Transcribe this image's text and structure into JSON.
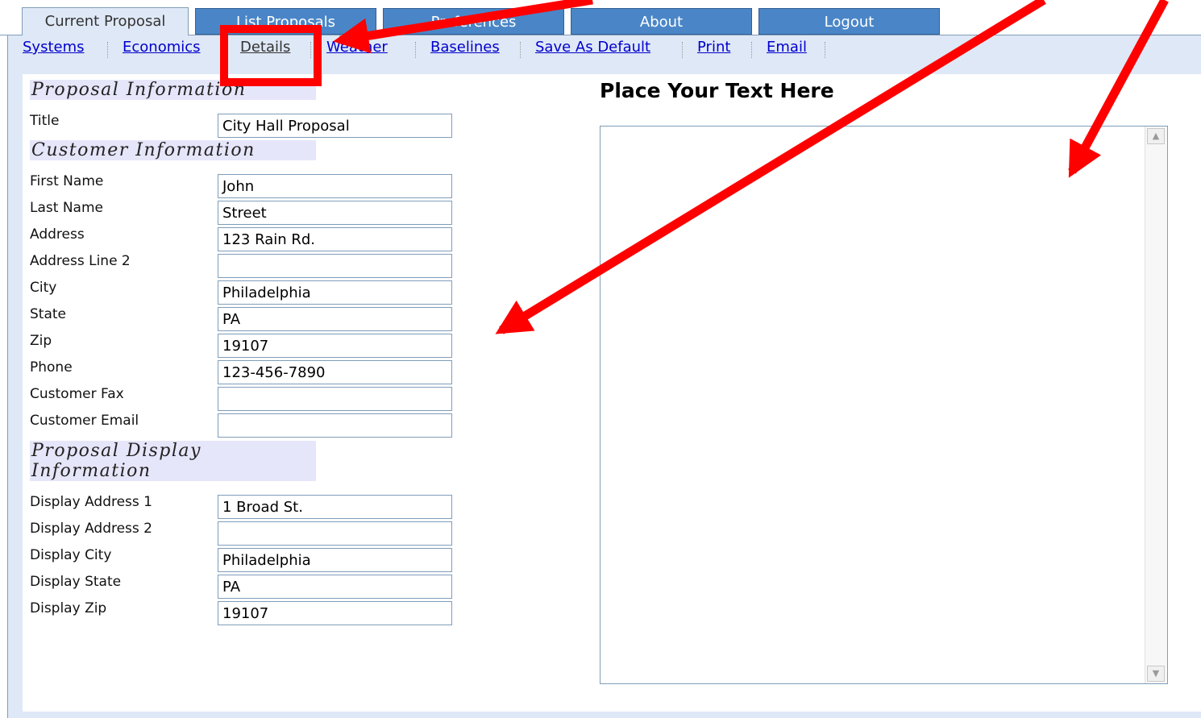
{
  "tabs": [
    {
      "label": "Current Proposal",
      "active": true
    },
    {
      "label": "List Proposals",
      "active": false
    },
    {
      "label": "Preferences",
      "active": false
    },
    {
      "label": "About",
      "active": false
    },
    {
      "label": "Logout",
      "active": false
    }
  ],
  "subnav": {
    "systems": "Systems",
    "economics": "Economics",
    "details": "Details",
    "weather": "Weather",
    "baselines": "Baselines",
    "save_default": "Save As Default",
    "print": "Print",
    "email": "Email"
  },
  "sections": {
    "proposal_info": "Proposal Information",
    "customer_info": "Customer Information",
    "display_info_line1": "Proposal Display",
    "display_info_line2": "Information"
  },
  "fields": {
    "title": {
      "label": "Title",
      "value": "City Hall Proposal"
    },
    "first_name": {
      "label": "First Name",
      "value": "John"
    },
    "last_name": {
      "label": "Last Name",
      "value": "Street"
    },
    "address": {
      "label": "Address",
      "value": "123 Rain Rd."
    },
    "address2": {
      "label": "Address Line 2",
      "value": ""
    },
    "city": {
      "label": "City",
      "value": "Philadelphia"
    },
    "state": {
      "label": "State",
      "value": "PA"
    },
    "zip": {
      "label": "Zip",
      "value": "19107"
    },
    "phone": {
      "label": "Phone",
      "value": "123-456-7890"
    },
    "fax": {
      "label": "Customer Fax",
      "value": ""
    },
    "email": {
      "label": "Customer Email",
      "value": ""
    },
    "display_address1": {
      "label": "Display Address 1",
      "value": "1 Broad St."
    },
    "display_address2": {
      "label": "Display Address 2",
      "value": ""
    },
    "display_city": {
      "label": "Display City",
      "value": "Philadelphia"
    },
    "display_state": {
      "label": "Display State",
      "value": "PA"
    },
    "display_zip": {
      "label": "Display Zip",
      "value": "19107"
    }
  },
  "text_panel": {
    "heading": "Place Your Text Here",
    "content": ""
  },
  "colors": {
    "tab_inactive": "#4a86c7",
    "tab_active": "#dfe8f6",
    "section_bg": "#e6e6fa",
    "annotation": "#ff0000"
  }
}
